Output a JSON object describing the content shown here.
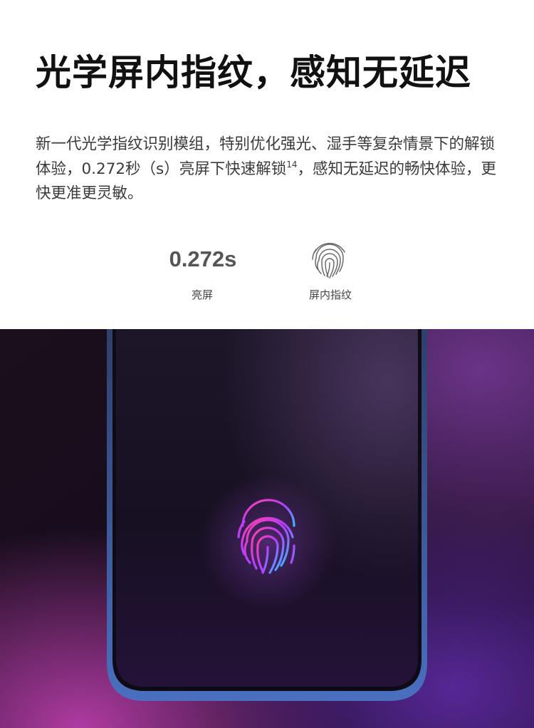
{
  "headline": "光学屏内指纹，感知无延迟",
  "description": {
    "text_before_sup": "新一代光学指纹识别模组，特别优化强光、湿手等复杂情景下的解锁体验，0.272秒（s）亮屏下快速解锁",
    "sup": "14",
    "text_after_sup": "，感知无延迟的畅快体验，更快更准更灵敏。"
  },
  "stats": [
    {
      "value": "0.272s",
      "label": "亮屏"
    },
    {
      "icon": "fingerprint-icon",
      "label": "屏内指纹"
    }
  ],
  "hero": {
    "glow_colors": [
      "#ff3fa0",
      "#b53cff",
      "#38b8ff"
    ],
    "phone_frame_color": "#4a6fbf"
  }
}
